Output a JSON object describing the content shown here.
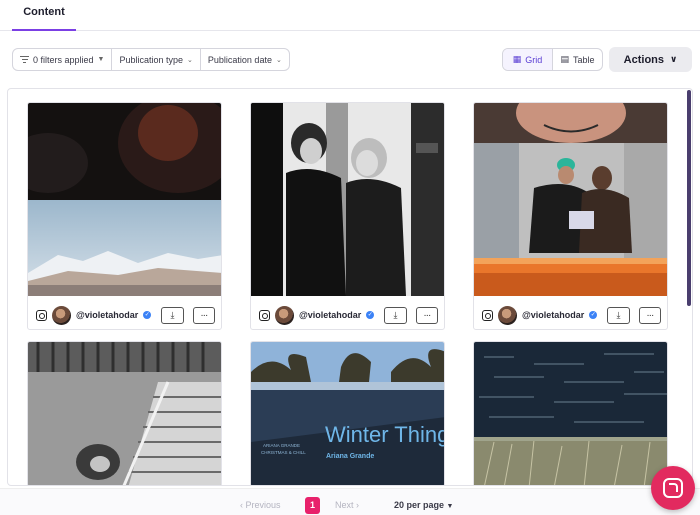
{
  "tabs": {
    "active_label": "Content"
  },
  "filters": {
    "filters_applied": "0 filters applied",
    "publication_type": "Publication type",
    "publication_date": "Publication date"
  },
  "view": {
    "grid_label": "Grid",
    "table_label": "Table",
    "actions_label": "Actions"
  },
  "cards": [
    {
      "handle": "@violetahodar",
      "platform": "instagram-icon"
    },
    {
      "handle": "@violetahodar",
      "platform": "instagram-icon"
    },
    {
      "handle": "@violetahodar",
      "platform": "instagram-icon"
    }
  ],
  "posters": {
    "title": "Winter Things",
    "artist": "Ariana Grande",
    "small_print": "ARIANA GRANDE\nCHRISTMAS & CHILL"
  },
  "pagination": {
    "previous": "Previous",
    "current_page": "1",
    "next": "Next",
    "per_page": "20 per page"
  },
  "colors": {
    "accent": "#7b3fe4",
    "page_active": "#e8216b",
    "chat": "#e22a5f"
  }
}
